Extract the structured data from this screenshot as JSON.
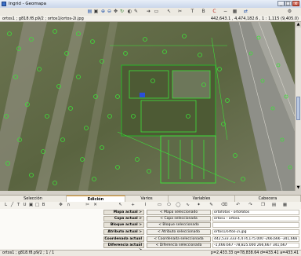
{
  "window": {
    "title": "Ingrid - Geomapa",
    "buttons": {
      "minimize": "_",
      "maximize": "□",
      "close": "x"
    }
  },
  "toolbar_icons": [
    "open-icon",
    "save-icon",
    "zoom-in-icon",
    "zoom-out-icon",
    "pan-icon",
    "refresh-icon",
    "contrast-icon",
    "pencil-icon",
    "arrow-icon",
    "ruler-icon",
    "cursor-icon",
    "tool-icon",
    "text-icon",
    "bold-icon",
    "color-icon",
    "minus-icon",
    "grid-icon",
    "navigation-icon",
    "settings-icon"
  ],
  "pathbar": {
    "left": "ortos1 ; g818.f8.p9/2 ; ortos1/ortos-2i.jpg",
    "right": "442,643.1 , 4,474,182.6 , 1 : 1,115 (9,405.0)"
  },
  "tabs": [
    {
      "label": "Selección",
      "active": false
    },
    {
      "label": "Edición",
      "active": true
    },
    {
      "label": "Varios",
      "active": false
    },
    {
      "label": "Variables",
      "active": false
    },
    {
      "label": "Cabecera",
      "active": false
    }
  ],
  "edit_rows": [
    {
      "label": "Mapa actual >",
      "button": "< Mapa seleccionado",
      "value": "ortofotos - ortofotos"
    },
    {
      "label": "Capa actual >",
      "button": "< Capa seleccionada",
      "value": "ortos1 - ortos1"
    },
    {
      "label": "Bloque actual >",
      "button": "< Bloque seleccionado",
      "value": ""
    },
    {
      "label": "Atributo actual >",
      "button": "< Atributo seleccionado",
      "value": "ortos1/ortos-2i.jpg"
    },
    {
      "label": "Coordenada actual >",
      "button": "< Coordenada seleccionada",
      "value": "442,533.333   4,474,175.000   -266,666   -341,666"
    },
    {
      "label": "Diferencia actual >",
      "button": "< Diferencia seleccionada",
      "value": "-1,466.667   -78,825.000   266,667   341,667"
    }
  ],
  "statusbar": {
    "left": "ortos1 ; g818.f8.p9/2 ; 1 / 1",
    "right": "p=2,433.33  q=78,838.64  d=433.41  a=433.41"
  },
  "colors": {
    "accent": "#e09c2e",
    "map_green": "#3fc23a"
  }
}
